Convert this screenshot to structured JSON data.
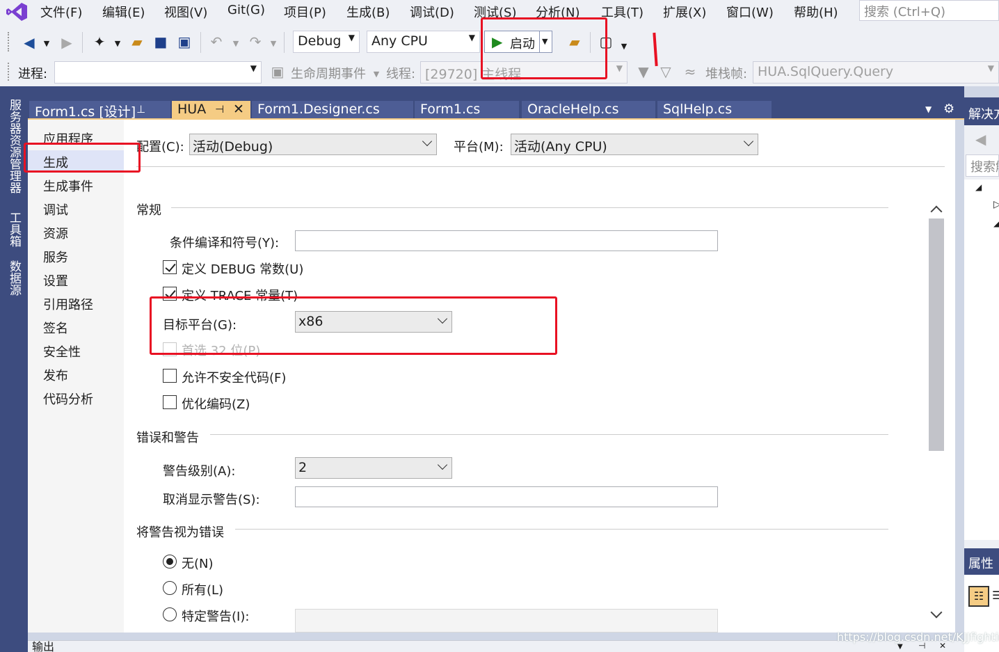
{
  "menu": {
    "items": [
      "文件(F)",
      "编辑(E)",
      "视图(V)",
      "Git(G)",
      "项目(P)",
      "生成(B)",
      "调试(D)",
      "测试(S)",
      "分析(N)",
      "工具(T)",
      "扩展(X)",
      "窗口(W)",
      "帮助(H)"
    ],
    "search_placeholder": "搜索 (Ctrl+Q)"
  },
  "toolbar": {
    "configuration": "Debug",
    "platform": "Any CPU",
    "start_label": "启动",
    "process_label": "进程:",
    "process_value": "",
    "lifecycle_label": "生命周期事件",
    "thread_label": "线程:",
    "thread_value": "[29720] 主线程",
    "stackframe_label": "堆栈帧:",
    "stackframe_value": "HUA.SqlQuery.Query"
  },
  "side_tabs": [
    "服务器资源管理器",
    "工具箱",
    "数据源"
  ],
  "doc_tabs": [
    "Form1.cs [设计]",
    "HUA",
    "Form1.Designer.cs",
    "Form1.cs",
    "OracleHelp.cs",
    "SqlHelp.cs"
  ],
  "active_doc_tab": "HUA",
  "nav": {
    "items": [
      "应用程序",
      "生成",
      "生成事件",
      "调试",
      "资源",
      "服务",
      "设置",
      "引用路径",
      "签名",
      "安全性",
      "发布",
      "代码分析"
    ],
    "selected": "生成"
  },
  "build_page": {
    "config_label": "配置(C):",
    "config_value": "活动(Debug)",
    "platform_label": "平台(M):",
    "platform_value": "活动(Any CPU)",
    "general_title": "常规",
    "conditional_symbols_label": "条件编译和符号(Y):",
    "conditional_symbols_value": "",
    "define_debug_label": "定义 DEBUG 常数(U)",
    "define_debug_checked": true,
    "define_trace_label": "定义 TRACE 常量(T)",
    "define_trace_checked": true,
    "target_platform_label": "目标平台(G):",
    "target_platform_value": "x86",
    "prefer32_label": "首选 32 位(P)",
    "prefer32_checked": false,
    "allow_unsafe_label": "允许不安全代码(F)",
    "allow_unsafe_checked": false,
    "optimize_label": "优化编码(Z)",
    "optimize_checked": false,
    "errors_title": "错误和警告",
    "warning_level_label": "警告级别(A):",
    "warning_level_value": "2",
    "suppress_warnings_label": "取消显示警告(S):",
    "suppress_warnings_value": "",
    "treat_warnings_title": "将警告视为错误",
    "radio_none_label": "无(N)",
    "radio_all_label": "所有(L)",
    "radio_specific_label": "特定警告(I):",
    "radio_selected": "无(N)"
  },
  "right_panel": {
    "solution_title": "解决方",
    "search_placeholder": "搜索解",
    "properties_title": "属性"
  },
  "bottom": {
    "output_label": "输出"
  },
  "watermark": "https://blog.csdn.net/KJJfighting",
  "colors": {
    "accent_dark": "#3d4c7f",
    "active_tab": "#f5cc84",
    "highlight_box": "#e81123",
    "start_green": "#1e8a1e"
  }
}
